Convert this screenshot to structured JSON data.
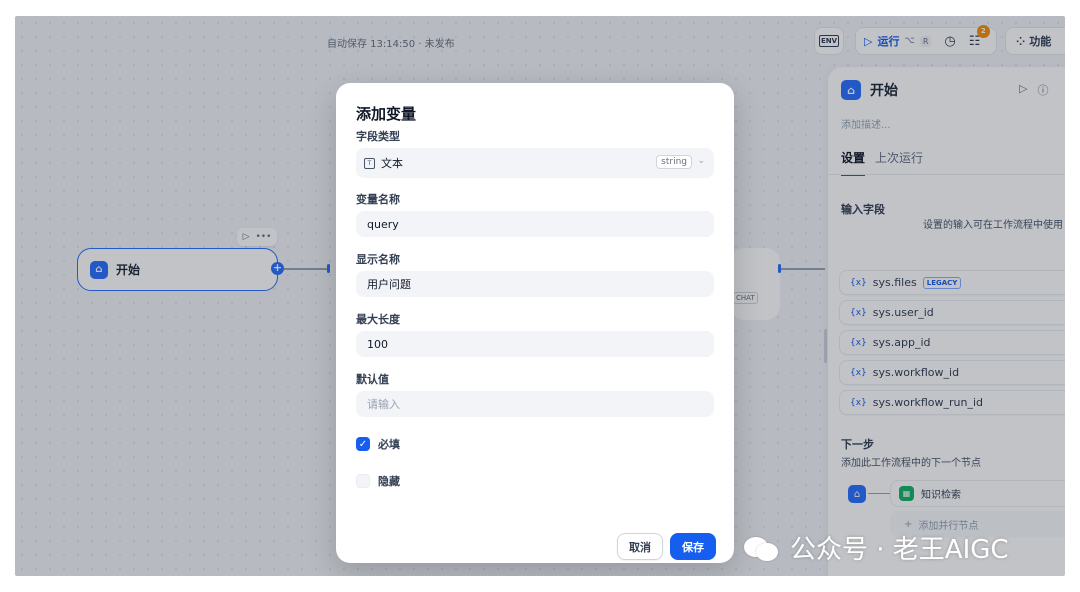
{
  "header": {
    "autosave": "自动保存 13:14:50 · 未发布",
    "env_label": "ENV",
    "run_label": "运行",
    "run_shortcut_alt": "⌥",
    "run_shortcut_key": "R",
    "checklist_count": "2",
    "features_label": "功能"
  },
  "canvas": {
    "start_node_label": "开始",
    "chat_tag": "CHAT"
  },
  "panel": {
    "title": "开始",
    "description_placeholder": "添加描述...",
    "tabs": [
      "设置",
      "上次运行"
    ],
    "input_fields_title": "输入字段",
    "input_fields_hint": "设置的输入可在工作流程中使用",
    "sys_vars": [
      {
        "name": "sys.files",
        "tag": "LEGACY"
      },
      {
        "name": "sys.user_id"
      },
      {
        "name": "sys.app_id"
      },
      {
        "name": "sys.workflow_id"
      },
      {
        "name": "sys.workflow_run_id"
      }
    ],
    "next_step_title": "下一步",
    "next_step_hint": "添加此工作流程中的下一个节点",
    "next_node_label": "知识检索",
    "add_parallel_label": "添加并行节点"
  },
  "modal": {
    "title": "添加变量",
    "field_type_label": "字段类型",
    "field_type_value": "文本",
    "field_type_tag": "string",
    "var_name_label": "变量名称",
    "var_name_value": "query",
    "display_name_label": "显示名称",
    "display_name_value": "用户问题",
    "max_length_label": "最大长度",
    "max_length_value": "100",
    "default_label": "默认值",
    "default_placeholder": "请输入",
    "required_label": "必填",
    "required_checked": true,
    "hidden_label": "隐藏",
    "hidden_checked": false,
    "cancel_label": "取消",
    "save_label": "保存"
  },
  "watermark": {
    "text": "公众号 · 老王AIGC"
  },
  "colors": {
    "accent": "#155eef",
    "overlay": "rgba(16,24,40,0.26)",
    "knowledge_node": "#16b364",
    "badge": "#f79009"
  }
}
